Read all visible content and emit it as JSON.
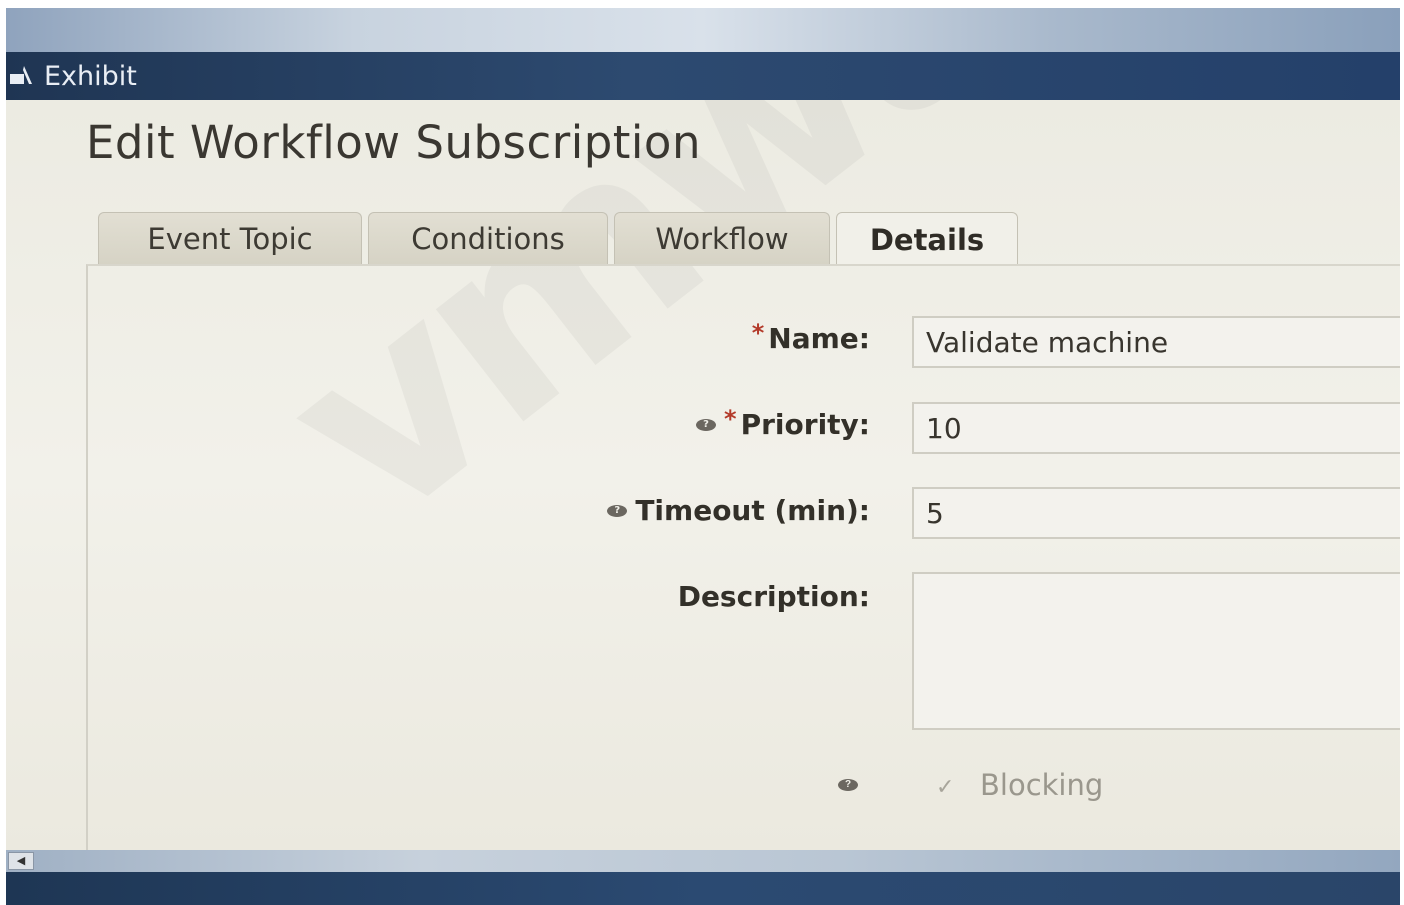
{
  "window": {
    "title": "Exhibit",
    "title_icon": "exhibit-icon"
  },
  "page": {
    "title": "Edit Workflow Subscription"
  },
  "tabs": [
    {
      "label": "Event Topic",
      "active": false
    },
    {
      "label": "Conditions",
      "active": false
    },
    {
      "label": "Workflow",
      "active": false
    },
    {
      "label": "Details",
      "active": true
    }
  ],
  "form": {
    "name": {
      "label": "Name:",
      "required": true,
      "value": "Validate machine"
    },
    "priority": {
      "label": "Priority:",
      "required": true,
      "help": true,
      "value": "10"
    },
    "timeout": {
      "label": "Timeout (min):",
      "required": false,
      "help": true,
      "value": "5"
    },
    "description": {
      "label": "Description:",
      "value": ""
    },
    "blocking": {
      "label": "Blocking",
      "checked": true,
      "help": true
    }
  },
  "scrollbar": {
    "left_arrow": "◀"
  },
  "colors": {
    "title_bar": "#24406a",
    "required_marker": "#b33a2a"
  }
}
